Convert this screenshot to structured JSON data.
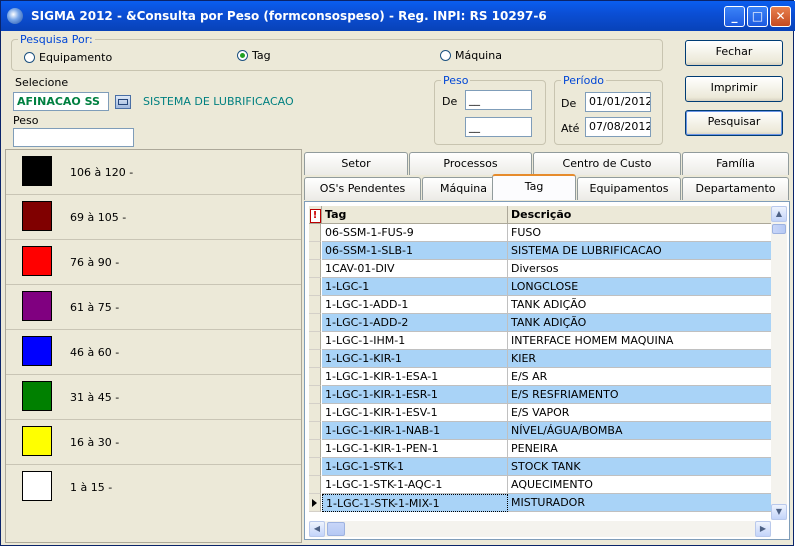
{
  "window": {
    "title": "SIGMA 2012 - &Consulta por Peso  (formconsospeso)  - Reg. INPI: RS 10297-6",
    "controls": {
      "minimize": "_",
      "maximize": "□",
      "close": "✕"
    }
  },
  "search": {
    "group_title": "Pesquisa Por:",
    "options": [
      {
        "label": "Equipamento",
        "selected": false
      },
      {
        "label": "Tag",
        "selected": true
      },
      {
        "label": "Máquina",
        "selected": false
      }
    ],
    "selecione_label": "Selecione",
    "selecione_value": "AFINACAO SS",
    "selecione_desc": "SISTEMA DE LUBRIFICACAO",
    "peso_label": "Peso",
    "peso_value": ""
  },
  "peso_group": {
    "title": "Peso",
    "de_label": "De",
    "de_value": "__",
    "ate_value": "__"
  },
  "periodo": {
    "title": "Período",
    "de_label": "De",
    "de_value": "01/01/2012",
    "ate_label": "Até",
    "ate_value": "07/08/2012"
  },
  "buttons": {
    "fechar": "Fechar",
    "imprimir": "Imprimir",
    "pesquisar": "Pesquisar"
  },
  "legend": [
    {
      "color": "#000000",
      "range": "106 à 120 -"
    },
    {
      "color": "#800000",
      "range": "69 à 105 -"
    },
    {
      "color": "#ff0000",
      "range": "76 à 90 -"
    },
    {
      "color": "#800080",
      "range": "61 à 75 -"
    },
    {
      "color": "#0000ff",
      "range": "46 à 60 -"
    },
    {
      "color": "#008000",
      "range": "31 à 45 -"
    },
    {
      "color": "#ffff00",
      "range": "16 à 30 -"
    },
    {
      "color": "#ffffff",
      "range": "1 à 15 -"
    }
  ],
  "tabs_row1": [
    "Setor",
    "Processos",
    "Centro de Custo",
    "Família"
  ],
  "tabs_row2": [
    "OS's Pendentes",
    "Máquina",
    "Tag",
    "Equipamentos",
    "Departamento"
  ],
  "active_tab": "Tag",
  "grid": {
    "columns": [
      "Tag",
      "Descrição"
    ],
    "rows": [
      [
        "06-SSM-1-FUS-9",
        "FUSO"
      ],
      [
        "06-SSM-1-SLB-1",
        "SISTEMA DE LUBRIFICACAO"
      ],
      [
        "1CAV-01-DIV",
        "Diversos"
      ],
      [
        "1-LGC-1",
        "LONGCLOSE"
      ],
      [
        "1-LGC-1-ADD-1",
        "TANK ADIÇÃO"
      ],
      [
        "1-LGC-1-ADD-2",
        "TANK ADIÇÃO"
      ],
      [
        "1-LGC-1-IHM-1",
        "INTERFACE HOMEM MAQUINA"
      ],
      [
        "1-LGC-1-KIR-1",
        "KIER"
      ],
      [
        "1-LGC-1-KIR-1-ESA-1",
        "E/S AR"
      ],
      [
        "1-LGC-1-KIR-1-ESR-1",
        "E/S RESFRIAMENTO"
      ],
      [
        "1-LGC-1-KIR-1-ESV-1",
        "E/S VAPOR"
      ],
      [
        "1-LGC-1-KIR-1-NAB-1",
        "NÍVEL/ÁGUA/BOMBA"
      ],
      [
        "1-LGC-1-KIR-1-PEN-1",
        "PENEIRA"
      ],
      [
        "1-LGC-1-STK-1",
        "STOCK TANK"
      ],
      [
        "1-LGC-1-STK-1-AQC-1",
        "AQUECIMENTO"
      ],
      [
        "1-LGC-1-STK-1-MIX-1",
        "MISTURADOR"
      ]
    ]
  }
}
